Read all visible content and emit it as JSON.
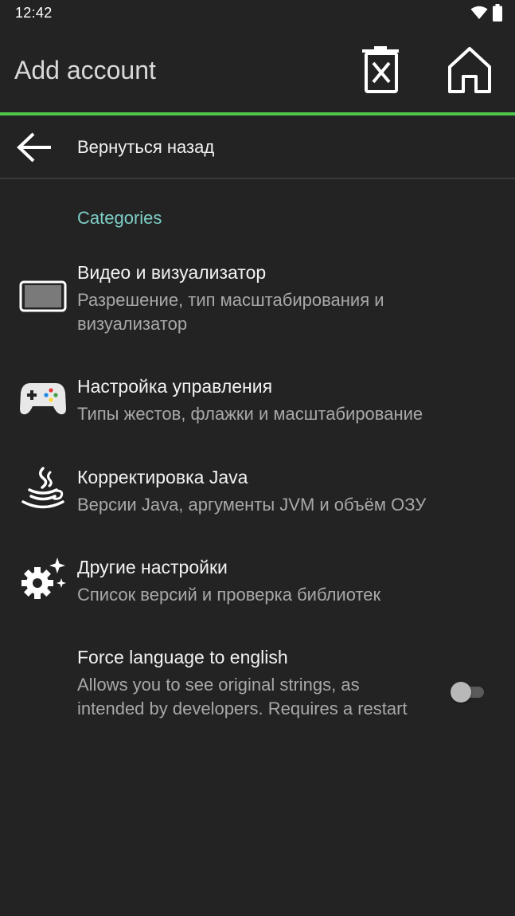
{
  "status_bar": {
    "time": "12:42",
    "icons": [
      "wifi-icon",
      "battery-icon"
    ]
  },
  "app_bar": {
    "title": "Add account",
    "actions": [
      "delete-icon",
      "home-icon"
    ]
  },
  "colors": {
    "background": "#232323",
    "accent": "#4ec64a",
    "category": "#7ecfc7",
    "title_text": "#f2f2f2",
    "summary_text": "#a8a8a8",
    "divider": "#3a3a3a"
  },
  "back": {
    "label": "Вернуться назад",
    "icon": "arrow-left-icon"
  },
  "category": {
    "title": "Categories"
  },
  "items": [
    {
      "title": "Видео и визуализатор",
      "summary": "Разрешение, тип масштабирования и визуализатор",
      "icon": "video-screen-icon"
    },
    {
      "title": "Настройка управления",
      "summary": "Типы жестов, флажки и масштабирование",
      "icon": "gamepad-icon"
    },
    {
      "title": "Корректировка Java",
      "summary": "Версии Java, аргументы JVM и объём ОЗУ",
      "icon": "java-icon"
    },
    {
      "title": "Другие настройки",
      "summary": "Список версий и проверка библиотек",
      "icon": "gear-sparkle-icon"
    },
    {
      "title": "Force language to english",
      "summary": "Allows you to see original strings, as intended by developers. Requires a restart",
      "icon": "",
      "toggle": false
    }
  ]
}
